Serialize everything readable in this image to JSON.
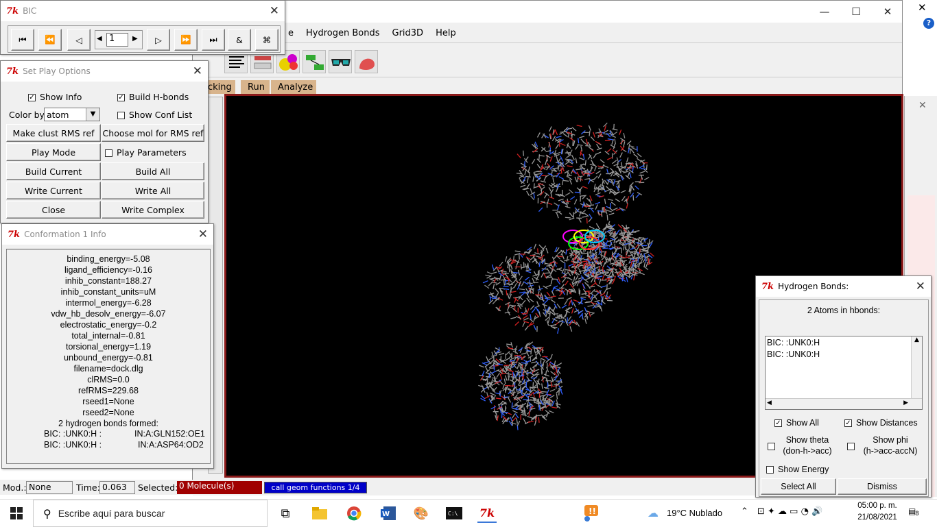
{
  "main_window": {
    "menus": [
      "e",
      "Hydrogen Bonds",
      "Grid3D",
      "Help"
    ],
    "tabs": [
      "cking",
      "Run",
      "Analyze"
    ],
    "status": {
      "mod_label": "Mod.:",
      "mod_value": "None",
      "time_label": "Time:",
      "time_value": "0.063",
      "selected_label": "Selected:",
      "selected_value": "0 Molecule(s)",
      "progress_text": "call geom functions 1/4"
    }
  },
  "bic_window": {
    "title": "BIC",
    "frame_value": "1",
    "buttons": [
      "⏮",
      "⏪",
      "◁",
      "▷",
      "⏩",
      "⏭",
      "&",
      "⌘"
    ]
  },
  "play_options": {
    "title": "Set Play Options",
    "show_info": "Show Info",
    "build_hbonds": "Build  H-bonds",
    "color_by_label": "Color by",
    "color_by_value": "atom",
    "show_conf_list": "Show Conf List",
    "make_clust": "Make clust RMS ref",
    "choose_mol": "Choose mol for RMS ref",
    "play_mode": "Play Mode",
    "play_parameters": "Play Parameters",
    "build_current": "Build Current",
    "build_all": "Build All",
    "write_current": "Write Current",
    "write_all": "Write All",
    "close": "Close",
    "write_complex": "Write Complex"
  },
  "conf_info": {
    "title": "Conformation 1 Info",
    "lines": [
      "binding_energy=-5.08",
      "ligand_efficiency=-0.16",
      "inhib_constant=188.27",
      "inhib_constant_units=uM",
      "intermol_energy=-6.28",
      "vdw_hb_desolv_energy=-6.07",
      "electrostatic_energy=-0.2",
      "total_internal=-0.81",
      "torsional_energy=1.19",
      "unbound_energy=-0.81",
      "filename=dock.dlg",
      "clRMS=0.0",
      "refRMS=229.68",
      "rseed1=None",
      "rseed2=None",
      "2 hydrogen bonds formed:"
    ],
    "hbonds": [
      {
        "donor": "BIC: :UNK0:H :",
        "acceptor": "IN:A:GLN152:OE1"
      },
      {
        "donor": "BIC: :UNK0:H :",
        "acceptor": "IN:A:ASP64:OD2"
      }
    ]
  },
  "hbonds_window": {
    "title": "Hydrogen Bonds:",
    "header": "2 Atoms in hbonds:",
    "items": [
      "BIC: :UNK0:H",
      "BIC: :UNK0:H"
    ],
    "show_all": "Show All",
    "show_distances": "Show Distances",
    "show_theta": "Show theta\n(don-h->acc)",
    "show_phi": "Show phi\n(h->acc-accN)",
    "show_energy": "Show Energy",
    "select_all": "Select All",
    "dismiss": "Dismiss"
  },
  "taskbar": {
    "search_placeholder": "Escribe aquí para buscar",
    "weather": "19°C  Nublado",
    "time": "05:00 p. m.",
    "date": "21/08/2021",
    "notifications": "8"
  },
  "colors": {
    "viewer_border": "#8b1a1a",
    "selected_bg": "#a00000",
    "progress_bg": "#0000c8",
    "tab_bg": "#d8b48c",
    "tk_logo": "#cc0000"
  }
}
